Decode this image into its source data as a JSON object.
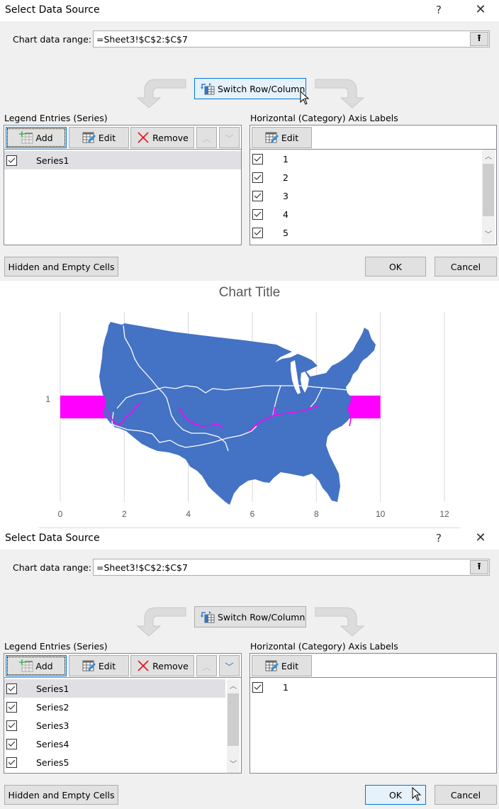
{
  "dialog_top": {
    "title": "Select Data Source",
    "help_icon": "?",
    "close_icon": "✕",
    "range_label": "Chart data range:",
    "range_value": "=Sheet3!$C$2:$C$7",
    "collapse_icon": "⭱",
    "switch_label": "Switch Row/Column",
    "legend_label": "Legend Entries (Series)",
    "legend_buttons": {
      "add": "Add",
      "edit": "Edit",
      "remove": "Remove",
      "up": "︿",
      "down": "﹀"
    },
    "series": [
      {
        "label": "Series1",
        "checked": true,
        "selected": true
      }
    ],
    "axis_label": "Horizontal (Category) Axis Labels",
    "axis_edit": "Edit",
    "categories": [
      {
        "label": "1",
        "checked": true
      },
      {
        "label": "2",
        "checked": true
      },
      {
        "label": "3",
        "checked": true
      },
      {
        "label": "4",
        "checked": true
      },
      {
        "label": "5",
        "checked": true
      }
    ],
    "hidden_cells": "Hidden and Empty Cells",
    "ok": "OK",
    "cancel": "Cancel"
  },
  "chart_data": {
    "type": "bar",
    "orientation": "horizontal",
    "title": "Chart Title",
    "categories": [
      "1"
    ],
    "series": [
      {
        "name": "Series1",
        "values": [
          10
        ],
        "color": "#ff00ff"
      }
    ],
    "xlim": [
      0,
      12
    ],
    "xticks": [
      "0",
      "2",
      "4",
      "6",
      "8",
      "10",
      "12"
    ],
    "grid": true,
    "xlabel": "",
    "ylabel": "",
    "overlay_image": "us-map-with-routes",
    "map_color": "#4472c4",
    "route_color": "#ff00ff"
  },
  "dialog_bottom": {
    "title": "Select Data Source",
    "help_icon": "?",
    "close_icon": "✕",
    "range_label": "Chart data range:",
    "range_value": "=Sheet3!$C$2:$C$7",
    "collapse_icon": "⭱",
    "switch_label": "Switch Row/Column",
    "legend_label": "Legend Entries (Series)",
    "legend_buttons": {
      "add": "Add",
      "edit": "Edit",
      "remove": "Remove",
      "up": "︿",
      "down": "﹀"
    },
    "series": [
      {
        "label": "Series1",
        "checked": true,
        "selected": true
      },
      {
        "label": "Series2",
        "checked": true
      },
      {
        "label": "Series3",
        "checked": true
      },
      {
        "label": "Series4",
        "checked": true
      },
      {
        "label": "Series5",
        "checked": true
      }
    ],
    "axis_label": "Horizontal (Category) Axis Labels",
    "axis_edit": "Edit",
    "categories": [
      {
        "label": "1",
        "checked": true
      }
    ],
    "hidden_cells": "Hidden and Empty Cells",
    "ok": "OK",
    "cancel": "Cancel"
  }
}
